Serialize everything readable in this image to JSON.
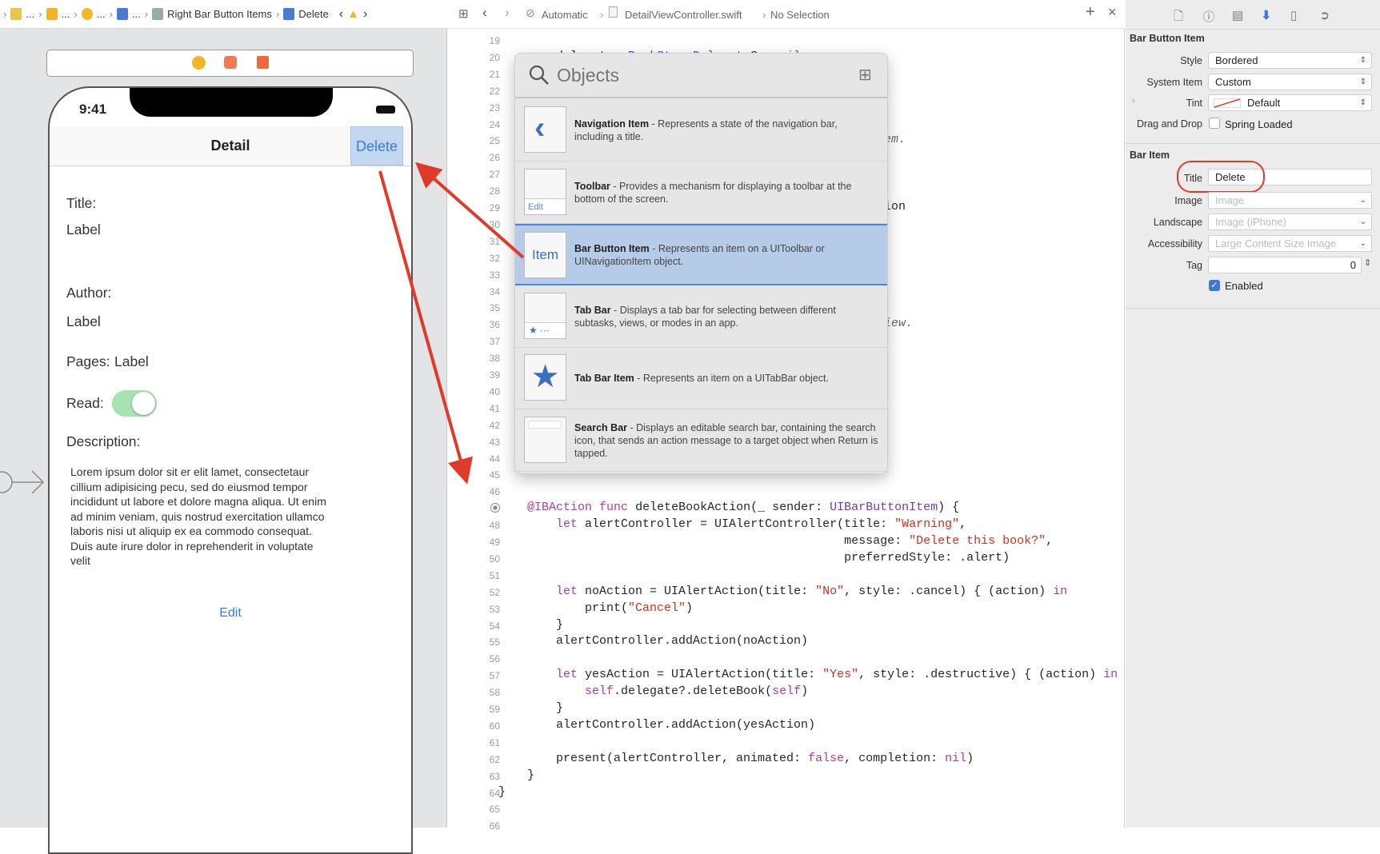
{
  "breadcrumb": {
    "items": [
      {
        "label": "...",
        "icon": "storyboard-file-icon",
        "color": "#e8c54a"
      },
      {
        "label": "...",
        "icon": "scene-icon",
        "color": "#f0b52a"
      },
      {
        "label": "...",
        "icon": "view-controller-icon",
        "color": "#f3b626"
      },
      {
        "label": "...",
        "icon": "navigation-item-icon",
        "color": "#4a7bd1"
      },
      {
        "label": "Right Bar Button Items",
        "icon": "bar-items-icon",
        "color": "#9aa"
      },
      {
        "label": "Delete",
        "icon": "bar-button-item-icon",
        "color": "#4a7bd1"
      }
    ],
    "warning_icon": "warning-icon"
  },
  "editor_bar": {
    "mode": "Automatic",
    "file": "DetailViewController.swift",
    "selection": "No Selection",
    "add": "+",
    "close": "×"
  },
  "phone": {
    "time": "9:41",
    "nav_title": "Detail",
    "delete_button": "Delete",
    "title_label": "Title:",
    "title_value": "Label",
    "author_label": "Author:",
    "author_value": "Label",
    "pages_label": "Pages:",
    "pages_value": "Label",
    "read_label": "Read:",
    "read_on": true,
    "description_label": "Description:",
    "description": "Lorem ipsum dolor sit er elit lamet, consectetaur cillium adipisicing pecu, sed do eiusmod tempor incididunt ut labore et dolore magna aliqua. Ut enim ad minim veniam, quis nostrud exercitation ullamco laboris nisi ut aliquip ex ea commodo consequat. Duis aute irure dolor in reprehenderit in voluptate velit",
    "edit_button": "Edit",
    "switch_color": "#a6e3b0",
    "tint": "#3a7bd5"
  },
  "code": {
    "first_line": 19,
    "breakpoint_line": 47,
    "lines": [
      [],
      [
        [
          "    ",
          ""
        ],
        [
          "var",
          "kw"
        ],
        [
          " delegate: ",
          ""
        ],
        [
          "BookStoreDelegate",
          "type"
        ],
        [
          "? = ",
          ""
        ],
        [
          "nil",
          "kw"
        ]
      ],
      [],
      [],
      [],
      [],
      [],
      [],
      [],
      [],
      [],
      [],
      [],
      [],
      [],
      [],
      [],
      [],
      [],
      [],
      [],
      [],
      [],
      [],
      [],
      [],
      [],
      [],
      [
        [
          "    ",
          ""
        ],
        [
          "@IBAction",
          "kw"
        ],
        [
          " ",
          ""
        ],
        [
          "func",
          "kw"
        ],
        [
          " deleteBookAction(_ sender: ",
          ""
        ],
        [
          "UIBarButtonItem",
          "type"
        ],
        [
          ") {",
          ""
        ]
      ],
      [
        [
          "        ",
          ""
        ],
        [
          "let",
          "kw"
        ],
        [
          " alertController = UIAlertController(title: ",
          ""
        ],
        [
          "\"Warning\"",
          "str"
        ],
        [
          ",",
          ""
        ]
      ],
      [
        [
          "                                                message: ",
          ""
        ],
        [
          "\"Delete this book?\"",
          "str"
        ],
        [
          ",",
          ""
        ]
      ],
      [
        [
          "                                                preferredStyle: .alert)",
          ""
        ]
      ],
      [],
      [
        [
          "        ",
          ""
        ],
        [
          "let",
          "kw"
        ],
        [
          " noAction = UIAlertAction(title: ",
          ""
        ],
        [
          "\"No\"",
          "str"
        ],
        [
          ", style: .cancel) { (action) ",
          ""
        ],
        [
          "in",
          "kw"
        ]
      ],
      [
        [
          "            print(",
          ""
        ],
        [
          "\"Cancel\"",
          "str"
        ],
        [
          ")",
          ""
        ]
      ],
      [
        [
          "        }",
          ""
        ]
      ],
      [
        [
          "        alertController.addAction(noAction)",
          ""
        ]
      ],
      [],
      [
        [
          "        ",
          ""
        ],
        [
          "let",
          "kw"
        ],
        [
          " yesAction = UIAlertAction(title: ",
          ""
        ],
        [
          "\"Yes\"",
          "str"
        ],
        [
          ", style: .destructive) { (action) ",
          ""
        ],
        [
          "in",
          "kw"
        ]
      ],
      [
        [
          "            ",
          ""
        ],
        [
          "self",
          "kw"
        ],
        [
          ".delegate?.deleteBook(",
          ""
        ],
        [
          "self",
          "kw"
        ],
        [
          ")",
          ""
        ]
      ],
      [
        [
          "        }",
          ""
        ]
      ],
      [
        [
          "        alertController.addAction(yesAction)",
          ""
        ]
      ],
      [],
      [
        [
          "        present(alertController, animated: ",
          ""
        ],
        [
          "false",
          "kw"
        ],
        [
          ", completion: ",
          ""
        ],
        [
          "nil",
          "kw"
        ],
        [
          ")",
          ""
        ]
      ],
      [
        [
          "    }",
          ""
        ]
      ],
      [
        [
          "}",
          ""
        ]
      ],
      [],
      []
    ],
    "fragments": [
      {
        "line": 25,
        "text": "em.",
        "kind": "comment"
      },
      {
        "line": 29,
        "text": "ion",
        "kind": ""
      },
      {
        "line": 36,
        "text": "iew.",
        "kind": "comment"
      }
    ]
  },
  "library": {
    "search_placeholder": "Objects",
    "items": [
      {
        "name": "Navigation Item",
        "desc": " - Represents a state of the navigation bar, including a title.",
        "icon": "chevron-left-icon"
      },
      {
        "name": "Toolbar",
        "desc": " - Provides a mechanism for displaying a toolbar at the bottom of the screen.",
        "icon": "toolbar-icon",
        "icon_text": "Edit"
      },
      {
        "name": "Bar Button Item",
        "desc": " - Represents an item on a UIToolbar or UINavigationItem object.",
        "icon": "bar-button-item-icon",
        "icon_text": "Item",
        "selected": true
      },
      {
        "name": "Tab Bar",
        "desc": " - Displays a tab bar for selecting between different subtasks, views, or modes in an app.",
        "icon": "tab-bar-icon",
        "icon_text": "★ ···"
      },
      {
        "name": "Tab Bar Item",
        "desc": " - Represents an item on a UITabBar object.",
        "icon": "star-icon",
        "icon_text": "★"
      },
      {
        "name": "Search Bar",
        "desc": " - Displays an editable search bar, containing the search icon, that sends an action message to a target object when Return is tapped.",
        "icon": "search-bar-icon"
      }
    ]
  },
  "inspector": {
    "tabs": [
      "file-inspector-icon",
      "help-icon",
      "identity-inspector-icon",
      "attributes-inspector-icon",
      "size-inspector-icon",
      "connections-inspector-icon"
    ],
    "active_tab": 3,
    "section1": {
      "title": "Bar Button Item",
      "style_label": "Style",
      "style": "Bordered",
      "system_item_label": "System Item",
      "system_item": "Custom",
      "tint_label": "Tint",
      "tint": "Default",
      "drag_label": "Drag and Drop",
      "spring_loaded": "Spring Loaded",
      "spring_checked": false
    },
    "section2": {
      "title": "Bar Item",
      "title_label": "Title",
      "title_value": "Delete",
      "image_label": "Image",
      "image_placeholder": "Image",
      "landscape_label": "Landscape",
      "landscape_placeholder": "Image (iPhone)",
      "accessibility_label": "Accessibility",
      "accessibility_placeholder": "Large Content Size Image",
      "tag_label": "Tag",
      "tag": "0",
      "enabled_label": "Enabled",
      "enabled": true
    }
  },
  "annotation_color": "#e03a2a"
}
